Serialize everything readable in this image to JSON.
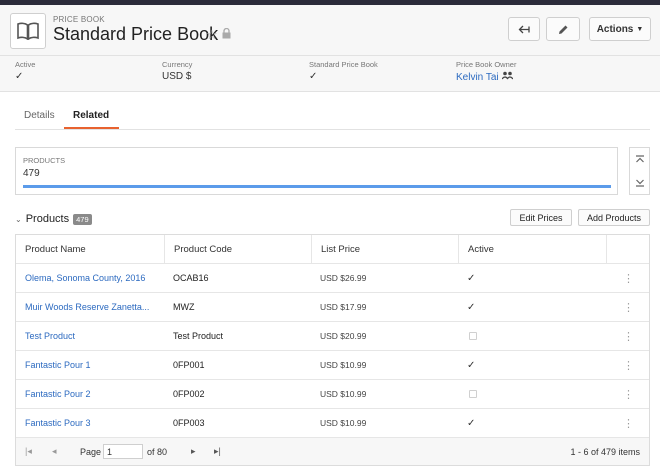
{
  "header": {
    "eyebrow": "PRICE BOOK",
    "title": "Standard Price Book",
    "actions_label": "Actions"
  },
  "fields": [
    {
      "label": "Active",
      "value": "✓"
    },
    {
      "label": "Currency",
      "value": "USD $"
    },
    {
      "label": "Standard Price Book",
      "value": "✓"
    },
    {
      "label": "Price Book Owner",
      "value": "Kelvin Tai"
    }
  ],
  "tabs": [
    {
      "label": "Details"
    },
    {
      "label": "Related"
    }
  ],
  "summary": {
    "label": "PRODUCTS",
    "value": "479"
  },
  "section": {
    "title": "Products",
    "count": "479",
    "edit_prices": "Edit Prices",
    "add_products": "Add Products"
  },
  "table": {
    "columns": [
      "Product Name",
      "Product Code",
      "List Price",
      "Active"
    ],
    "rows": [
      {
        "name": "Olema, Sonoma County, 2016",
        "code": "OCAB16",
        "price": "USD $26.99",
        "active": true
      },
      {
        "name": "Muir Woods Reserve Zanetta...",
        "code": "MWZ",
        "price": "USD $17.99",
        "active": true
      },
      {
        "name": "Test Product",
        "code": "Test Product",
        "price": "USD $20.99",
        "active": false
      },
      {
        "name": "Fantastic Pour 1",
        "code": "0FP001",
        "price": "USD $10.99",
        "active": true
      },
      {
        "name": "Fantastic Pour 2",
        "code": "0FP002",
        "price": "USD $10.99",
        "active": false
      },
      {
        "name": "Fantastic Pour 3",
        "code": "0FP003",
        "price": "USD $10.99",
        "active": true
      }
    ]
  },
  "pager": {
    "page_label": "Page",
    "page_value": "1",
    "of_label": "of 80",
    "range": "1 - 6 of 479 items"
  },
  "colors": {
    "accent_tab": "#e8622f",
    "link": "#2c6ac0",
    "progress": "#5b9bea"
  }
}
